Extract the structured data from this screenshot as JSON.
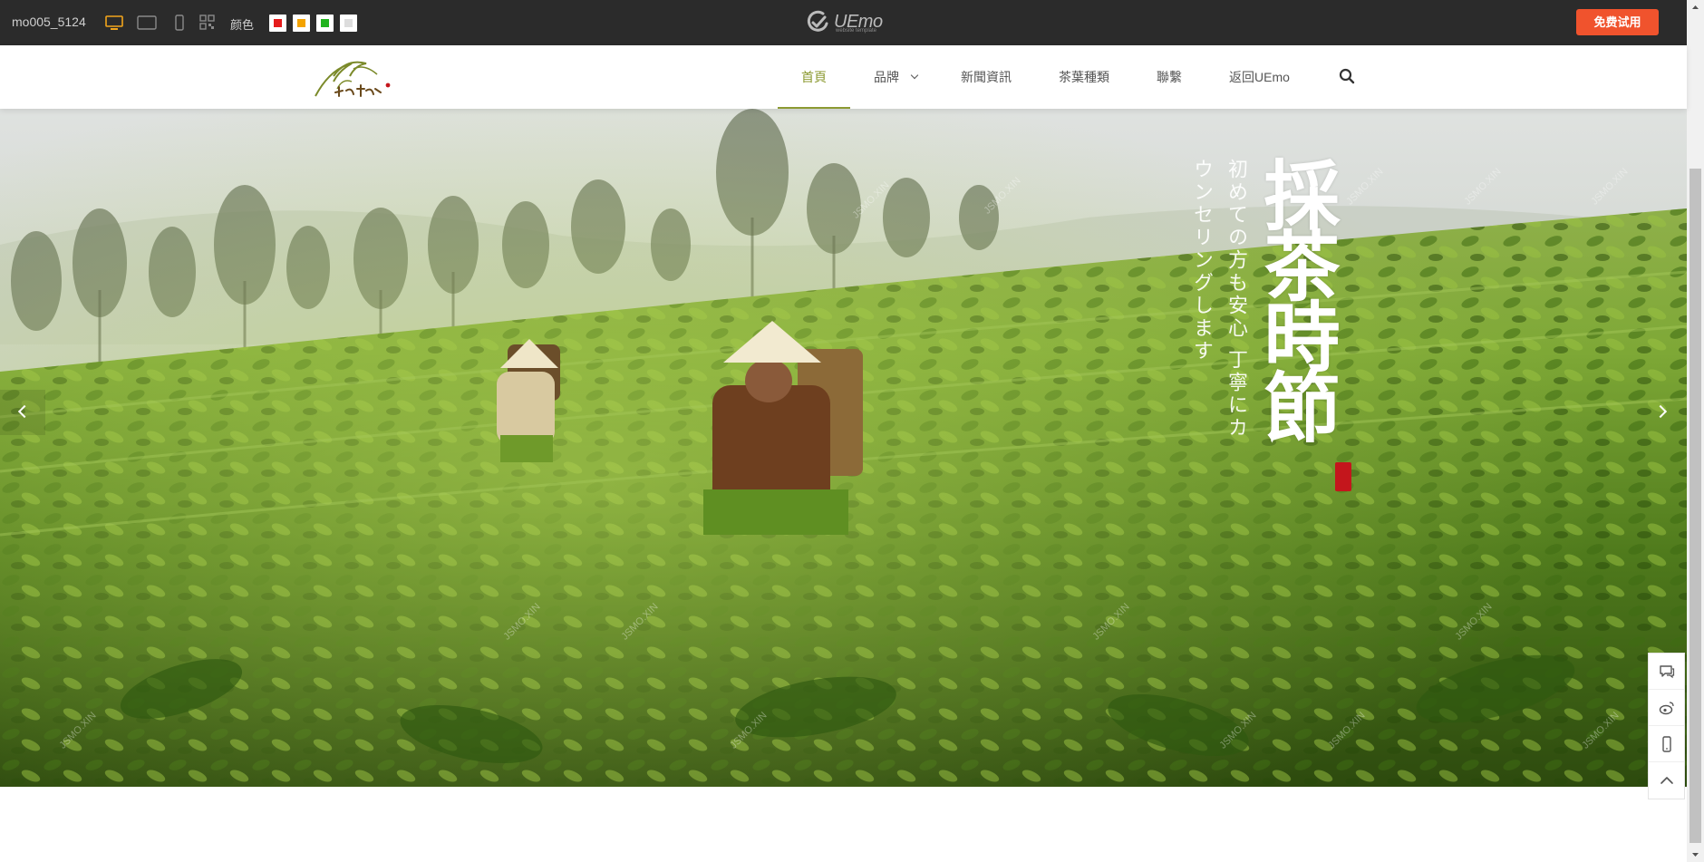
{
  "toolbar": {
    "template_code": "mo005_5124",
    "color_label": "颜色",
    "swatch_colors": [
      "#e51c1c",
      "#f4a300",
      "#22b41f",
      "#dddddd"
    ],
    "logo_text": "UEmo",
    "logo_tagline": "website template",
    "trial_button": "免费试用",
    "icons": [
      "desktop-icon",
      "tablet-icon",
      "phone-icon",
      "qr-code-icon",
      "uemo-logo-icon"
    ]
  },
  "header": {
    "brand_logo_alt": "金茗鼎祥",
    "nav": [
      {
        "label": "首頁",
        "active": true
      },
      {
        "label": "品牌",
        "has_dropdown": true
      },
      {
        "label": "新聞資訊"
      },
      {
        "label": "茶葉種類"
      },
      {
        "label": "聯繫"
      },
      {
        "label": "返回UEmo"
      }
    ],
    "accent_color": "#8c9a32",
    "icons": [
      "search-icon",
      "chevron-down-icon"
    ]
  },
  "hero": {
    "title": "採茶時節",
    "subtitle_vertical": "初めての方も安心 丁寧にカウンセリングします",
    "watermark": "JSMO.XIN",
    "icons": [
      "prev-arrow-icon",
      "next-arrow-icon"
    ]
  },
  "side_tools": {
    "icons": [
      "chat-icon",
      "weibo-icon",
      "mobile-icon",
      "back-to-top-icon"
    ]
  }
}
